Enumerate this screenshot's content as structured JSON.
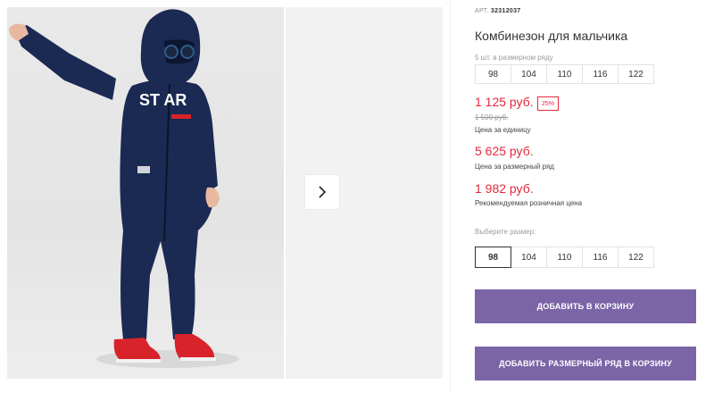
{
  "product": {
    "sku_label": "АРТ.",
    "sku_value": "32312037",
    "title": "Комбинезон для мальчика",
    "set_label": "5 шт. в размерном ряду",
    "set_sizes": [
      "98",
      "104",
      "110",
      "116",
      "122"
    ],
    "price": "1 125 руб.",
    "discount": "25%",
    "old_price": "1 500 руб.",
    "price_caption": "Цена за единицу",
    "set_price": "5 625 руб.",
    "set_price_caption": "Цена за размерный ряд",
    "rrp_price": "1 982 руб.",
    "rrp_caption": "Рекомендуемая розничная цена",
    "choose_label": "Выберите размер:",
    "sizes": [
      "98",
      "104",
      "110",
      "116",
      "122"
    ],
    "selected_size": "98",
    "add_to_cart": "ДОБАВИТЬ В КОРЗИНУ",
    "add_set_to_cart": "ДОБАВИТЬ РАЗМЕРНЫЙ РЯД В КОРЗИНУ"
  },
  "photo": {
    "print_text": "ST AR",
    "icons": [
      "chevron-right-icon"
    ]
  },
  "colors": {
    "accent": "#7b65a7",
    "price": "#e4283a",
    "garment": "#1a2a52",
    "shoes": "#d8232b"
  }
}
